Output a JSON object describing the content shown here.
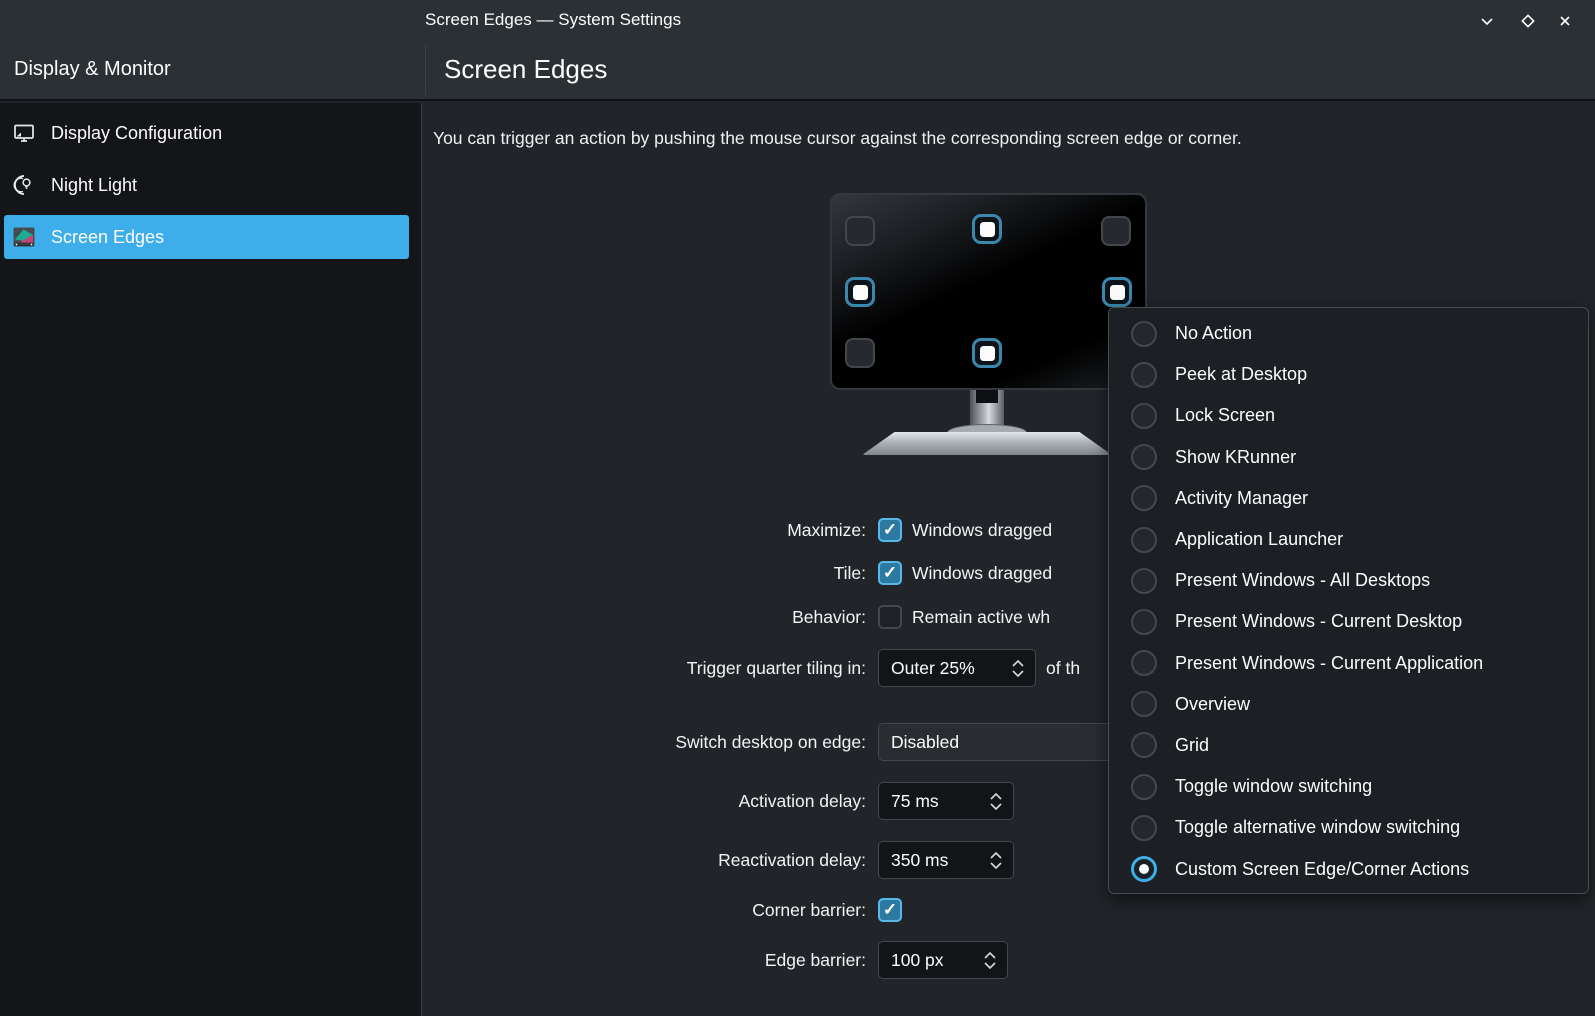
{
  "colors": {
    "accent": "#3daee9",
    "chrome_bg": "#2b3035",
    "sidebar_bg": "#131518",
    "main_bg": "#212529",
    "menu_bg": "#1c2024",
    "field_bg": "#121517",
    "combo_bg": "#292d32",
    "border": "#43484e",
    "checkbox_checked_fill": "#2c7aa1",
    "edge_active_ring": "#3b88af",
    "text": "#fcfcfc"
  },
  "window": {
    "title": "Screen Edges — System Settings",
    "controls": [
      {
        "name": "minimize"
      },
      {
        "name": "maximize"
      },
      {
        "name": "close"
      }
    ]
  },
  "header": {
    "section_title": "Display & Monitor",
    "page_title": "Screen Edges"
  },
  "sidebar": {
    "items": [
      {
        "label": "Display Configuration",
        "icon": "display-icon",
        "selected": false
      },
      {
        "label": "Night Light",
        "icon": "night-light-icon",
        "selected": false
      },
      {
        "label": "Screen Edges",
        "icon": "screen-edges-icon",
        "selected": true
      }
    ]
  },
  "content": {
    "intro": "You can trigger an action by pushing the mouse cursor against the corresponding screen edge or corner."
  },
  "monitor": {
    "edges": [
      {
        "position": "top-left",
        "active": false
      },
      {
        "position": "top-center",
        "active": true
      },
      {
        "position": "top-right",
        "active": false
      },
      {
        "position": "middle-left",
        "active": true
      },
      {
        "position": "middle-right",
        "active": true
      },
      {
        "position": "bottom-left",
        "active": false
      },
      {
        "position": "bottom-center",
        "active": true
      }
    ]
  },
  "form": {
    "rows": [
      {
        "label": "Maximize:",
        "type": "checkbox",
        "checked": true,
        "text": "Windows dragged"
      },
      {
        "label": "Tile:",
        "type": "checkbox",
        "checked": true,
        "text": "Windows dragged"
      },
      {
        "label": "Behavior:",
        "type": "checkbox",
        "checked": false,
        "text": "Remain active wh"
      },
      {
        "label": "Trigger quarter tiling in:",
        "type": "spinbox",
        "value": "Outer 25%",
        "suffix": "of th"
      },
      {
        "label": "Switch desktop on edge:",
        "type": "combobox",
        "value": "Disabled"
      },
      {
        "label": "Activation delay:",
        "type": "spinbox",
        "value": "75 ms"
      },
      {
        "label": "Reactivation delay:",
        "type": "spinbox",
        "value": "350 ms"
      },
      {
        "label": "Corner barrier:",
        "type": "checkbox",
        "checked": true,
        "text": ""
      },
      {
        "label": "Edge barrier:",
        "type": "spinbox",
        "value": "100 px"
      }
    ]
  },
  "menu": {
    "items": [
      {
        "label": "No Action",
        "selected": false
      },
      {
        "label": "Peek at Desktop",
        "selected": false
      },
      {
        "label": "Lock Screen",
        "selected": false
      },
      {
        "label": "Show KRunner",
        "selected": false
      },
      {
        "label": "Activity Manager",
        "selected": false
      },
      {
        "label": "Application Launcher",
        "selected": false
      },
      {
        "label": "Present Windows - All Desktops",
        "selected": false
      },
      {
        "label": "Present Windows - Current Desktop",
        "selected": false
      },
      {
        "label": "Present Windows - Current Application",
        "selected": false
      },
      {
        "label": "Overview",
        "selected": false
      },
      {
        "label": "Grid",
        "selected": false
      },
      {
        "label": "Toggle window switching",
        "selected": false
      },
      {
        "label": "Toggle alternative window switching",
        "selected": false
      },
      {
        "label": "Custom Screen Edge/Corner Actions",
        "selected": true
      }
    ]
  }
}
